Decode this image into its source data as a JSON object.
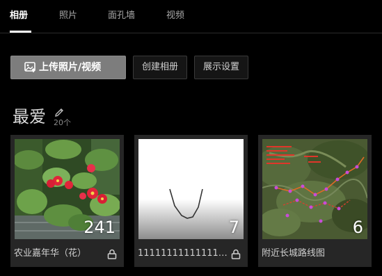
{
  "tabs": [
    {
      "label": "相册",
      "active": true
    },
    {
      "label": "照片",
      "active": false
    },
    {
      "label": "面孔墙",
      "active": false
    },
    {
      "label": "视频",
      "active": false
    }
  ],
  "toolbar": {
    "upload_label": "上传照片/视频",
    "upload_icon": "upload-image-icon",
    "create_album_label": "创建相册",
    "display_settings_label": "展示设置"
  },
  "album": {
    "title": "最爱",
    "edit_icon": "pencil-icon",
    "count_label": "20个"
  },
  "cards": [
    {
      "name": "农业嘉年华（花）",
      "count": "241",
      "locked": true,
      "thumb": "red-flowers-photo"
    },
    {
      "name": "11111111111111111...",
      "count": "7",
      "locked": true,
      "thumb": "line-drawing"
    },
    {
      "name": "附近长城路线图",
      "count": "6",
      "locked": false,
      "thumb": "satellite-route-map"
    }
  ],
  "colors": {
    "background": "#000000",
    "card": "#262626",
    "primary_button": "#7d7d7d",
    "flower_red": "#e0253a",
    "route_purple": "#c84cd8"
  }
}
